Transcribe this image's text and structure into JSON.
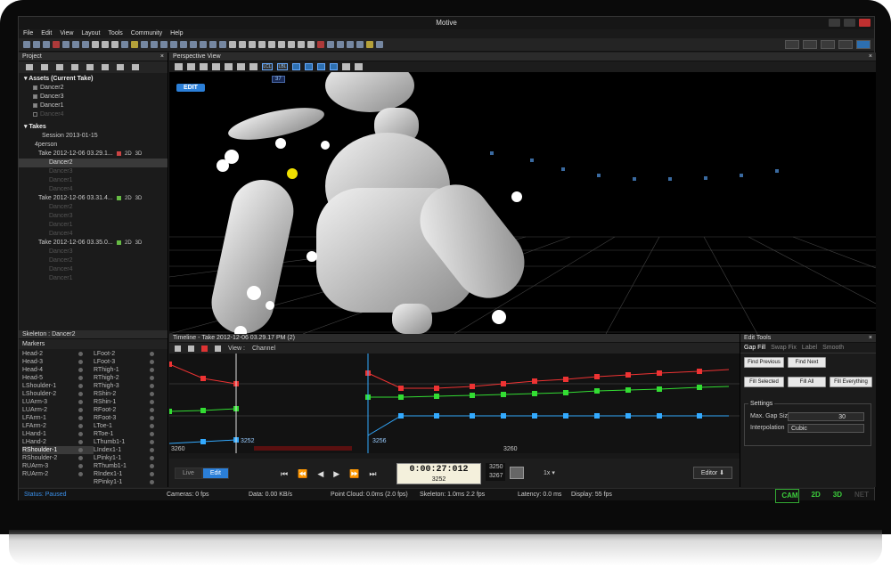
{
  "app": {
    "title": "Motive"
  },
  "menu": [
    "File",
    "Edit",
    "View",
    "Layout",
    "Tools",
    "Community",
    "Help"
  ],
  "project": {
    "header": "Project",
    "close": "×",
    "assets_title": "Assets (Current Take)",
    "assets": [
      {
        "name": "Dancer2",
        "state": "on"
      },
      {
        "name": "Dancer3",
        "state": "on"
      },
      {
        "name": "Dancer1",
        "state": "on"
      },
      {
        "name": "Dancer4",
        "state": "dim"
      }
    ],
    "takes_title": "Takes",
    "session": "Session 2013-01-15",
    "group": "4person",
    "takes": [
      {
        "name": "Take 2012-12-06 03.29.1...",
        "color": "#c44",
        "b2": "2D",
        "b3": "3D",
        "items": [
          "Dancer2",
          "Dancer3",
          "Dancer1",
          "Dancer4"
        ],
        "selected": "Dancer2"
      },
      {
        "name": "Take 2012-12-06 03.31.4...",
        "color": "#6b4",
        "b2": "2D",
        "b3": "3D",
        "items": [
          "Dancer2",
          "Dancer3",
          "Dancer1",
          "Dancer4"
        ]
      },
      {
        "name": "Take 2012-12-06 03.35.0...",
        "color": "#6b4",
        "b2": "2D",
        "b3": "3D",
        "items": [
          "Dancer3",
          "Dancer2",
          "Dancer4",
          "Dancer1"
        ]
      }
    ]
  },
  "skeleton": {
    "header": "Skeleton : Dancer2",
    "markers_label": "Markers",
    "left": [
      "Head-2",
      "Head-3",
      "Head-4",
      "Head-5",
      "LShoulder-1",
      "LShoulder-2",
      "LUArm-3",
      "LUArm-2",
      "LFArm-1",
      "LFArm-2",
      "LHand-1",
      "LHand-2",
      "RShoulder-1",
      "RShoulder-2",
      "RUArm-3",
      "RUArm-2"
    ],
    "right": [
      "LFoot-2",
      "LFoot-3",
      "RThigh-1",
      "RThigh-2",
      "RThigh-3",
      "RShin-2",
      "RShin-1",
      "RFoot-2",
      "RFoot-3",
      "LToe-1",
      "RToe-1",
      "LThumb1-1",
      "LIndex1-1",
      "LPinky1-1",
      "RThumb1-1",
      "RIndex1-1",
      "RPinky1-1"
    ],
    "selected": "RShoulder-1"
  },
  "viewport": {
    "header": "Perspective View",
    "close": "×",
    "edit_label": "EDIT",
    "marker_tag": "37",
    "lcl": "LCL",
    "lbl": "LBL"
  },
  "timeline": {
    "header": "Timeline",
    "take": "Take 2012-12-06 03.29.17 PM (2)",
    "view_label": "View :",
    "view_value": "Channel",
    "frame_left": "3260",
    "frame_mid": "3260",
    "cursor1": "3252",
    "cursor2": "3256",
    "live": "Live",
    "edit": "Edit",
    "time": "0:00:27:012",
    "frame": "3252",
    "start": "3250",
    "end": "3267",
    "speed": "1x",
    "editor": "Editor"
  },
  "edit_tools": {
    "header": "Edit Tools",
    "tabs": [
      "Gap Fill",
      "Swap Fix",
      "Label",
      "Smooth"
    ],
    "buttons": [
      "Find Previous",
      "Find Next",
      "Fill Selected",
      "Fill All",
      "Fill Everything"
    ],
    "settings_label": "Settings",
    "gap_label": "Max. Gap Size",
    "gap_value": "30",
    "interp_label": "Interpolation",
    "interp_value": "Cubic"
  },
  "status": {
    "state": "Status: Paused",
    "cameras": "Cameras: 0 fps",
    "data": "Data: 0.00 KB/s",
    "cloud": "Point Cloud: 0.0ms (2.0 fps)",
    "skeleton": "Skeleton: 1.0ms 2.2 fps",
    "latency": "Latency: 0.0 ms",
    "display": "Display: 55 fps",
    "modes": [
      "CAM",
      "2D",
      "3D",
      "NET"
    ]
  }
}
